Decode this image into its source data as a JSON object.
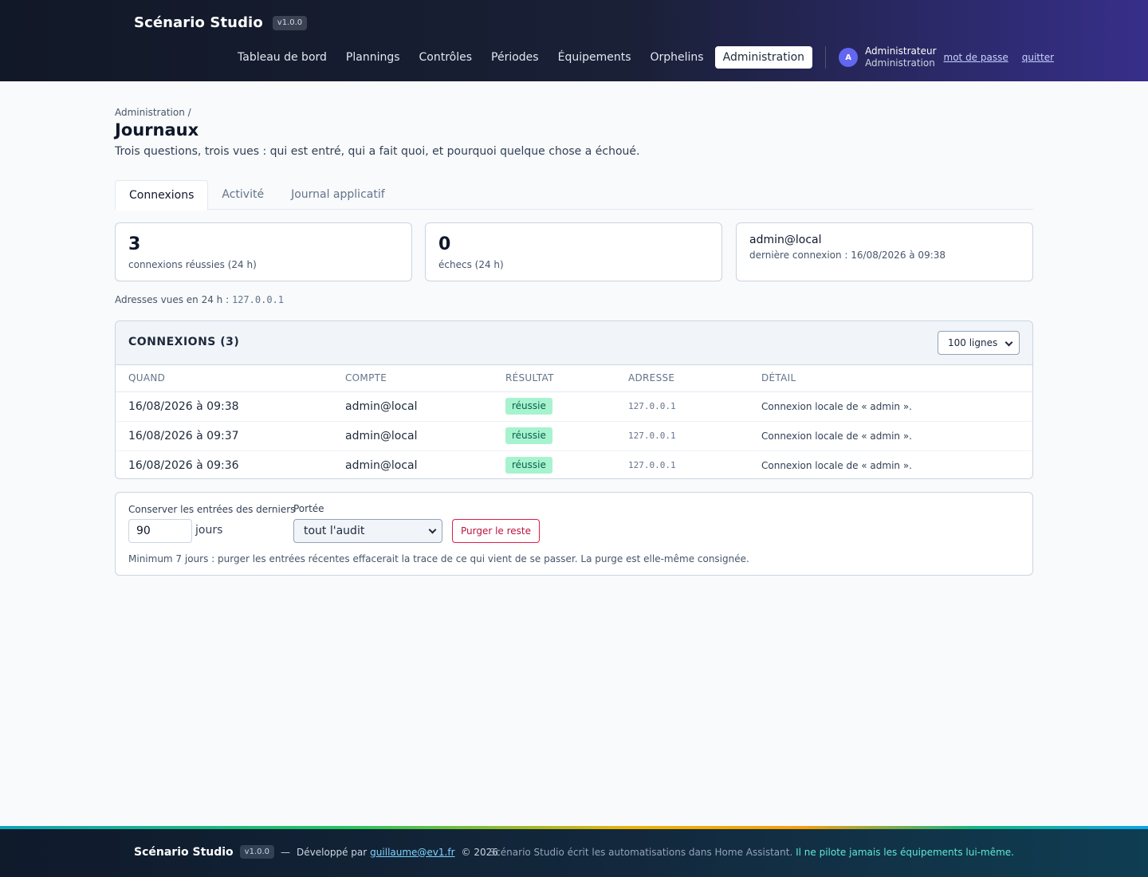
{
  "header": {
    "app_name": "Scénario Studio",
    "version": "v1.0.0",
    "nav": [
      {
        "label": "Tableau de bord"
      },
      {
        "label": "Plannings"
      },
      {
        "label": "Contrôles"
      },
      {
        "label": "Périodes"
      },
      {
        "label": "Équipements"
      },
      {
        "label": "Orphelins"
      },
      {
        "label": "Administration",
        "active": true
      }
    ],
    "user": {
      "avatar_letter": "A",
      "name": "Administrateur",
      "role": "Administration",
      "password_link": "mot de passe",
      "quit_link": "quitter"
    }
  },
  "page": {
    "breadcrumb": "Administration /",
    "title": "Journaux",
    "subtitle": "Trois questions, trois vues : qui est entré, qui a fait quoi, et pourquoi quelque chose a échoué."
  },
  "tabs": [
    {
      "label": "Connexions",
      "active": true
    },
    {
      "label": "Activité"
    },
    {
      "label": "Journal applicatif"
    }
  ],
  "stats": {
    "success": {
      "value": "3",
      "label": "connexions réussies (24 h)"
    },
    "failures": {
      "value": "0",
      "label": "échecs (24 h)"
    },
    "last": {
      "account": "admin@local",
      "label": "dernière connexion : 16/08/2026 à 09:38"
    }
  },
  "addresses": {
    "label": "Adresses vues en 24 h :",
    "value": "127.0.0.1"
  },
  "table": {
    "title": "CONNEXIONS (3)",
    "rows_select": "100 lignes",
    "columns": [
      "QUAND",
      "COMPTE",
      "RÉSULTAT",
      "ADRESSE",
      "DÉTAIL"
    ],
    "rows": [
      {
        "when": "16/08/2026 à 09:38",
        "account": "admin@local",
        "result": "réussie",
        "address": "127.0.0.1",
        "detail": "Connexion locale de « admin »."
      },
      {
        "when": "16/08/2026 à 09:37",
        "account": "admin@local",
        "result": "réussie",
        "address": "127.0.0.1",
        "detail": "Connexion locale de « admin »."
      },
      {
        "when": "16/08/2026 à 09:36",
        "account": "admin@local",
        "result": "réussie",
        "address": "127.0.0.1",
        "detail": "Connexion locale de « admin »."
      }
    ]
  },
  "purge": {
    "keep_label": "Conserver les entrées des derniers",
    "days_value": "90",
    "days_unit": "jours",
    "scope_label": "Portée",
    "scope_value": "tout l'audit",
    "button": "Purger le reste",
    "note": "Minimum 7 jours : purger les entrées récentes effacerait la trace de ce qui vient de se passer. La purge est elle-même consignée."
  },
  "footer": {
    "brand": "Scénario Studio",
    "version": "v1.0.0",
    "dash": "—",
    "developed_by": "Développé par",
    "email": "guillaume@ev1.fr",
    "copyright": "© 2026",
    "tagline": "Scénario Studio écrit les automatisations dans Home Assistant.",
    "tagline_highlight": "Il ne pilote jamais les équipements lui-même."
  }
}
